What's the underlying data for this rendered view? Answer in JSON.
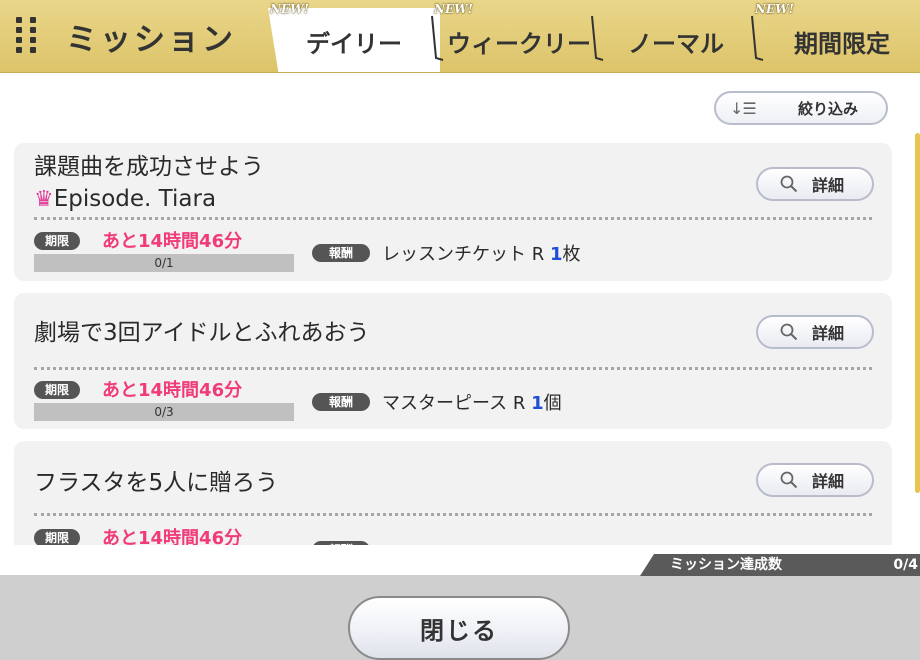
{
  "header": {
    "title": "ミッション",
    "new_badge": "NEW!",
    "tabs": [
      {
        "label": "デイリー",
        "active": true,
        "new": true
      },
      {
        "label": "ウィークリー",
        "active": false,
        "new": true
      },
      {
        "label": "ノーマル",
        "active": false,
        "new": false
      },
      {
        "label": "期間限定",
        "active": false,
        "new": true
      }
    ]
  },
  "filter": {
    "label": "絞り込み",
    "icon": "sort-icon"
  },
  "labels": {
    "period": "期限",
    "reward": "報酬",
    "detail": "詳細"
  },
  "missions": [
    {
      "title": "課題曲を成功させよう",
      "subtitle": "Episode. Tiara",
      "subtitle_icon": "crown-icon",
      "time_left": "あと14時間46分",
      "progress_text": "0/1",
      "progress": 0,
      "reward_name": "レッスンチケット R",
      "reward_qty": "1",
      "reward_unit": "枚"
    },
    {
      "title": "劇場で3回アイドルとふれあおう",
      "time_left": "あと14時間46分",
      "progress_text": "0/3",
      "progress": 0,
      "reward_name": "マスターピース R",
      "reward_qty": "1",
      "reward_unit": "個"
    },
    {
      "title": "フラスタを5人に贈ろう",
      "time_left": "あと14時間46分"
    }
  ],
  "footer": {
    "achievement_label": "ミッション達成数",
    "achievement_value": "0/4",
    "close_label": "閉じる"
  },
  "colors": {
    "header_gold": "#ddc46a",
    "time_pink": "#f03a7a",
    "qty_blue": "#1f4fd6",
    "crown_pink": "#e23b97"
  }
}
